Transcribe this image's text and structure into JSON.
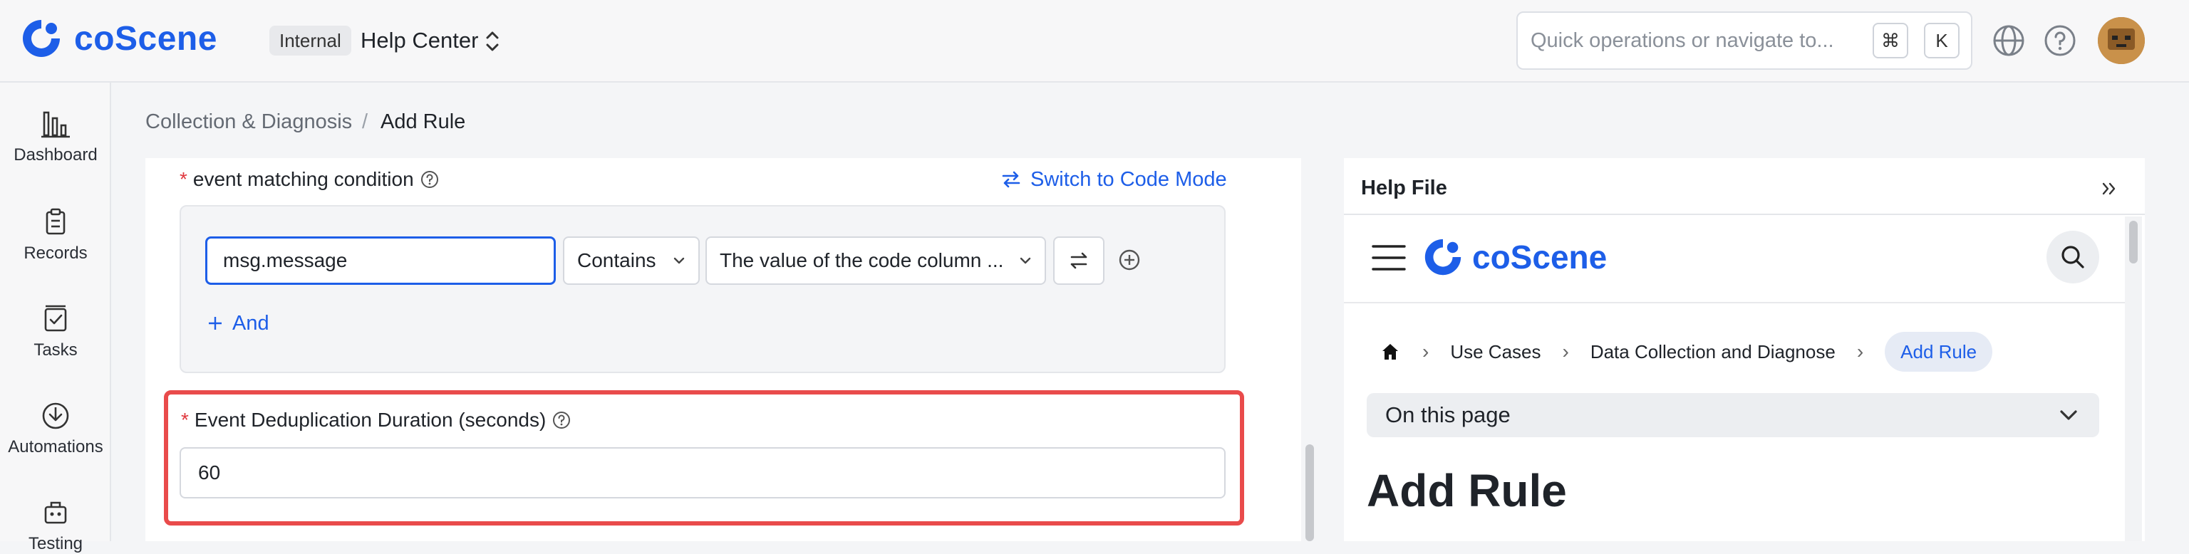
{
  "app": {
    "name": "coScene",
    "env_badge": "Internal",
    "project": "Help Center"
  },
  "search": {
    "placeholder": "Quick operations or navigate to...",
    "shortcut_key1": "⌘",
    "shortcut_key2": "K"
  },
  "sidebar": {
    "items": [
      {
        "label": "Dashboard",
        "icon": "bar-chart-icon"
      },
      {
        "label": "Records",
        "icon": "records-icon"
      },
      {
        "label": "Tasks",
        "icon": "tasks-icon"
      },
      {
        "label": "Automations",
        "icon": "automations-icon"
      },
      {
        "label": "Testing",
        "icon": "testing-icon"
      }
    ]
  },
  "breadcrumb": {
    "parent": "Collection & Diagnosis",
    "separator": "/",
    "current": "Add Rule"
  },
  "form": {
    "event_condition": {
      "required_mark": "*",
      "label": "event matching condition",
      "switch_mode_label": "Switch to Code Mode",
      "field_value": "msg.message",
      "operator_value": "Contains",
      "value_value": "The value of the code column ...",
      "add_label": "And"
    },
    "dedup": {
      "required_mark": "*",
      "label": "Event Deduplication Duration (seconds)",
      "value": "60"
    }
  },
  "help_panel": {
    "title": "Help File",
    "doc_logo": "coScene",
    "breadcrumb": [
      "Use Cases",
      "Data Collection and Diagnose",
      "Add Rule"
    ],
    "on_this_page": "On this page",
    "heading": "Add Rule"
  },
  "colors": {
    "brand": "#1d5ee8",
    "required": "#e0383e",
    "highlight": "#e94b4b"
  }
}
